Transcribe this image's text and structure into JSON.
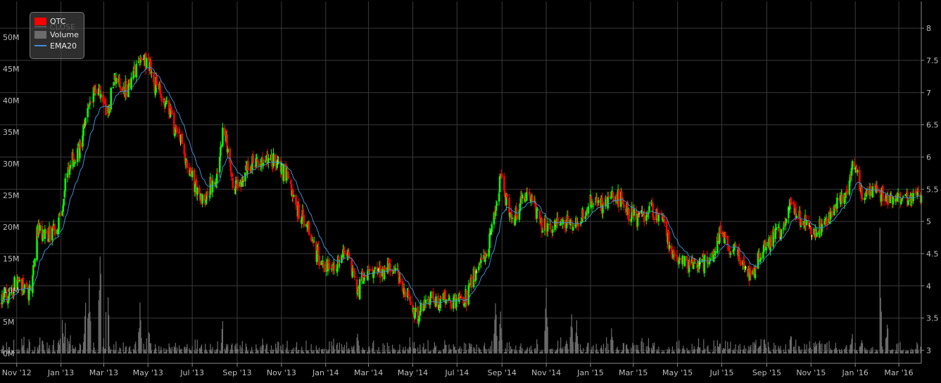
{
  "colors": {
    "background": "#000000",
    "grid": "#3a3a3a",
    "up": "#00ff00",
    "down": "#ff0000",
    "doji": "#ffff66",
    "volume": "#6b6b6b",
    "ema": "#3d8fd8",
    "axis_text": "#bdbdbd"
  },
  "legend": {
    "items": [
      {
        "label": "QTC",
        "type": "swatch",
        "color": "#ff0000"
      },
      {
        "label": "CLOSE",
        "type": "line",
        "color": "#555555",
        "faded": true
      },
      {
        "label": "Volume",
        "type": "swatch",
        "color": "#6b6b6b"
      },
      {
        "label": "EMA20",
        "type": "line",
        "color": "#3d8fd8"
      }
    ]
  },
  "chart_data": {
    "type": "candlestick",
    "title": "",
    "x_tick_labels": [
      "Nov '12",
      "Jan '13",
      "Mar '13",
      "May '13",
      "Jul '13",
      "Sep '13",
      "Nov '13",
      "Jan '14",
      "Mar '14",
      "May '14",
      "Jul '14",
      "Sep '14",
      "Nov '14",
      "Jan '15",
      "Mar '15",
      "May '15",
      "Jul '15",
      "Sep '15",
      "Nov '15",
      "Jan '16",
      "Mar '16"
    ],
    "x_tick_offsets": [
      0,
      61,
      120,
      181,
      242,
      304,
      365,
      426,
      485,
      546,
      607,
      669,
      730,
      791,
      850,
      911,
      972,
      1034,
      1095,
      1156,
      1216
    ],
    "x_range_days": [
      -23,
      1247
    ],
    "y_left": {
      "label": "",
      "ticks": [
        "0M",
        "5M",
        "10M",
        "15M",
        "20M",
        "25M",
        "30M",
        "35M",
        "40M",
        "45M",
        "50M"
      ],
      "range": [
        0,
        55000000
      ]
    },
    "y_right": {
      "label": "",
      "ticks": [
        "3",
        "3.5",
        "4",
        "4.5",
        "5",
        "5.5",
        "6",
        "6.5",
        "7",
        "7.5",
        "8"
      ],
      "range": [
        2.95,
        8.35
      ]
    },
    "close_anchors": [
      [
        -23,
        3.75
      ],
      [
        -10,
        3.9
      ],
      [
        0,
        4.05
      ],
      [
        10,
        3.95
      ],
      [
        18,
        3.92
      ],
      [
        22,
        4.1
      ],
      [
        28,
        4.85
      ],
      [
        40,
        4.75
      ],
      [
        55,
        4.95
      ],
      [
        62,
        5.15
      ],
      [
        68,
        5.65
      ],
      [
        75,
        5.95
      ],
      [
        85,
        6.05
      ],
      [
        95,
        6.65
      ],
      [
        105,
        7.0
      ],
      [
        115,
        7.05
      ],
      [
        125,
        6.6
      ],
      [
        135,
        7.25
      ],
      [
        148,
        7.0
      ],
      [
        160,
        7.2
      ],
      [
        170,
        7.55
      ],
      [
        181,
        7.45
      ],
      [
        192,
        7.1
      ],
      [
        205,
        6.85
      ],
      [
        220,
        6.4
      ],
      [
        232,
        6.05
      ],
      [
        245,
        5.5
      ],
      [
        258,
        5.4
      ],
      [
        268,
        5.55
      ],
      [
        278,
        5.75
      ],
      [
        284,
        6.4
      ],
      [
        291,
        6.1
      ],
      [
        298,
        5.55
      ],
      [
        305,
        5.5
      ],
      [
        315,
        5.75
      ],
      [
        325,
        5.9
      ],
      [
        338,
        5.9
      ],
      [
        350,
        5.95
      ],
      [
        362,
        5.85
      ],
      [
        372,
        5.75
      ],
      [
        382,
        5.35
      ],
      [
        390,
        5.05
      ],
      [
        400,
        5.0
      ],
      [
        410,
        4.6
      ],
      [
        420,
        4.35
      ],
      [
        432,
        4.25
      ],
      [
        445,
        4.35
      ],
      [
        455,
        4.5
      ],
      [
        465,
        4.2
      ],
      [
        470,
        3.9
      ],
      [
        478,
        4.2
      ],
      [
        485,
        4.2
      ],
      [
        495,
        4.2
      ],
      [
        505,
        4.25
      ],
      [
        515,
        4.3
      ],
      [
        525,
        4.2
      ],
      [
        535,
        3.95
      ],
      [
        545,
        3.65
      ],
      [
        552,
        3.45
      ],
      [
        558,
        3.75
      ],
      [
        568,
        3.8
      ],
      [
        578,
        3.75
      ],
      [
        590,
        3.78
      ],
      [
        600,
        3.75
      ],
      [
        607,
        3.8
      ],
      [
        615,
        3.75
      ],
      [
        622,
        3.85
      ],
      [
        630,
        4.15
      ],
      [
        640,
        4.3
      ],
      [
        650,
        4.6
      ],
      [
        660,
        5.15
      ],
      [
        667,
        5.75
      ],
      [
        675,
        5.3
      ],
      [
        685,
        4.95
      ],
      [
        695,
        5.35
      ],
      [
        705,
        5.45
      ],
      [
        715,
        5.2
      ],
      [
        725,
        4.9
      ],
      [
        735,
        4.95
      ],
      [
        745,
        5.05
      ],
      [
        755,
        4.9
      ],
      [
        765,
        5.0
      ],
      [
        772,
        4.9
      ],
      [
        780,
        5.1
      ],
      [
        790,
        5.3
      ],
      [
        800,
        5.25
      ],
      [
        810,
        5.25
      ],
      [
        820,
        5.4
      ],
      [
        832,
        5.35
      ],
      [
        845,
        5.1
      ],
      [
        855,
        5.05
      ],
      [
        865,
        5.15
      ],
      [
        875,
        5.2
      ],
      [
        885,
        5.05
      ],
      [
        895,
        4.85
      ],
      [
        905,
        4.45
      ],
      [
        915,
        4.35
      ],
      [
        930,
        4.35
      ],
      [
        945,
        4.35
      ],
      [
        958,
        4.4
      ],
      [
        970,
        4.85
      ],
      [
        980,
        4.6
      ],
      [
        992,
        4.55
      ],
      [
        1002,
        4.3
      ],
      [
        1010,
        4.1
      ],
      [
        1020,
        4.35
      ],
      [
        1030,
        4.55
      ],
      [
        1040,
        4.7
      ],
      [
        1050,
        4.85
      ],
      [
        1060,
        4.95
      ],
      [
        1068,
        5.4
      ],
      [
        1075,
        5.1
      ],
      [
        1085,
        5.0
      ],
      [
        1095,
        4.85
      ],
      [
        1105,
        4.9
      ],
      [
        1115,
        5.0
      ],
      [
        1125,
        5.2
      ],
      [
        1135,
        5.3
      ],
      [
        1145,
        5.5
      ],
      [
        1152,
        5.85
      ],
      [
        1158,
        5.75
      ],
      [
        1165,
        5.4
      ],
      [
        1175,
        5.45
      ],
      [
        1185,
        5.45
      ],
      [
        1200,
        5.35
      ],
      [
        1215,
        5.35
      ],
      [
        1247,
        5.4
      ]
    ],
    "ema_label": "EMA20",
    "volume_label": "Volume",
    "volume_spikes": [
      [
        62,
        8000000
      ],
      [
        68,
        7000000
      ],
      [
        75,
        5000000
      ],
      [
        95,
        10000000
      ],
      [
        100,
        14000000
      ],
      [
        115,
        22000000
      ],
      [
        125,
        20000000
      ],
      [
        170,
        9000000
      ],
      [
        181,
        8000000
      ],
      [
        284,
        6000000
      ],
      [
        470,
        4000000
      ],
      [
        545,
        3000000
      ],
      [
        660,
        9000000
      ],
      [
        667,
        8000000
      ],
      [
        730,
        12000000
      ],
      [
        765,
        7000000
      ],
      [
        772,
        6000000
      ],
      [
        820,
        4000000
      ],
      [
        1068,
        4000000
      ],
      [
        1152,
        4000000
      ],
      [
        1165,
        3000000
      ],
      [
        1190,
        20000000
      ],
      [
        1200,
        6000000
      ]
    ]
  }
}
